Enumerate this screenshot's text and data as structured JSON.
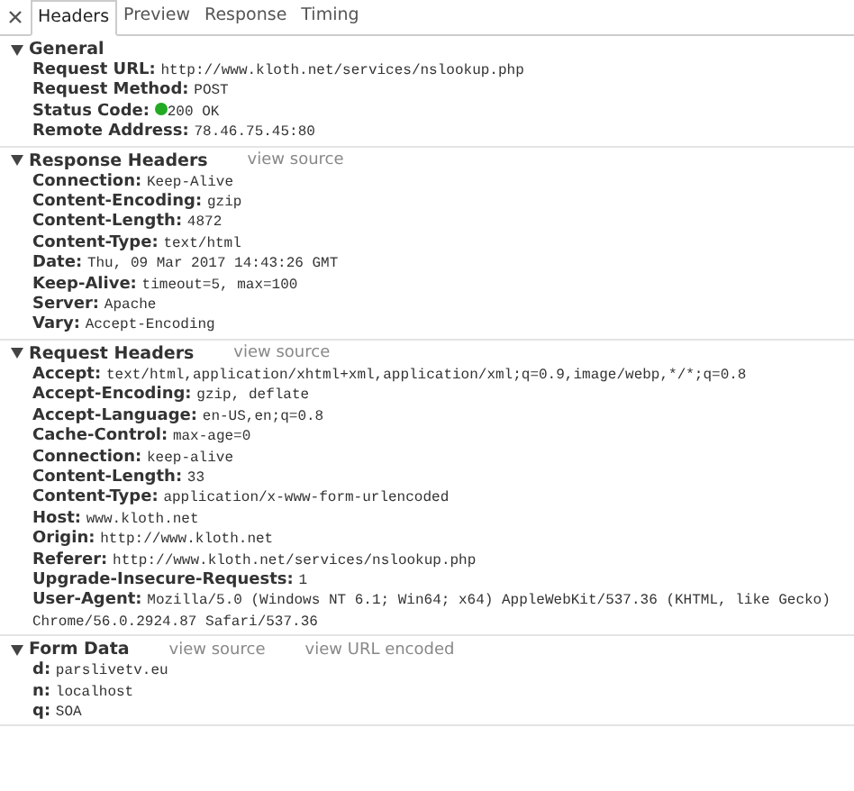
{
  "tabs": [
    {
      "label": "Headers",
      "selected": true
    },
    {
      "label": "Preview",
      "selected": false
    },
    {
      "label": "Response",
      "selected": false
    },
    {
      "label": "Timing",
      "selected": false
    }
  ],
  "sections": [
    {
      "title": "General",
      "expanded": true,
      "rows": [
        {
          "name": "Request URL:",
          "value": "http://www.kloth.net/services/nslookup.php"
        },
        {
          "name": "Request Method:",
          "value": "POST"
        },
        {
          "name": "Status Code:",
          "value": "200 OK",
          "color": "#22aa22"
        },
        {
          "name": "Remote Address:",
          "value": "78.46.75.45:80"
        }
      ]
    },
    {
      "title": "Response Headers",
      "expanded": true,
      "links": [
        "view source"
      ],
      "rows": [
        {
          "name": "Connection:",
          "value": "Keep-Alive"
        },
        {
          "name": "Content-Encoding:",
          "value": "gzip"
        },
        {
          "name": "Content-Length:",
          "value": "4872"
        },
        {
          "name": "Content-Type:",
          "value": "text/html"
        },
        {
          "name": "Date:",
          "value": "Thu, 09 Mar 2017 14:43:26 GMT"
        },
        {
          "name": "Keep-Alive:",
          "value": "timeout=5, max=100"
        },
        {
          "name": "Server:",
          "value": "Apache"
        },
        {
          "name": "Vary:",
          "value": "Accept-Encoding"
        }
      ]
    },
    {
      "title": "Request Headers",
      "expanded": true,
      "links": [
        "view source"
      ],
      "rows": [
        {
          "name": "Accept:",
          "value": "text/html,application/xhtml+xml,application/xml;q=0.9,image/webp,*/*;q=0.8"
        },
        {
          "name": "Accept-Encoding:",
          "value": "gzip, deflate"
        },
        {
          "name": "Accept-Language:",
          "value": "en-US,en;q=0.8"
        },
        {
          "name": "Cache-Control:",
          "value": "max-age=0"
        },
        {
          "name": "Connection:",
          "value": "keep-alive"
        },
        {
          "name": "Content-Length:",
          "value": "33"
        },
        {
          "name": "Content-Type:",
          "value": "application/x-www-form-urlencoded"
        },
        {
          "name": "Host:",
          "value": "www.kloth.net"
        },
        {
          "name": "Origin:",
          "value": "http://www.kloth.net"
        },
        {
          "name": "Referer:",
          "value": "http://www.kloth.net/services/nslookup.php"
        },
        {
          "name": "Upgrade-Insecure-Requests:",
          "value": "1"
        },
        {
          "name": "User-Agent:",
          "value": "Mozilla/5.0 (Windows NT 6.1; Win64; x64) AppleWebKit/537.36 (KHTML, like Gecko) Chrome/56.0.2924.87 Safari/537.36"
        }
      ]
    },
    {
      "title": "Form Data",
      "expanded": true,
      "links": [
        "view source",
        "view URL encoded"
      ],
      "rows": [
        {
          "name": "d:",
          "value": "parslivetv.eu"
        },
        {
          "name": "n:",
          "value": "localhost"
        },
        {
          "name": "q:",
          "value": "SOA"
        }
      ]
    }
  ]
}
